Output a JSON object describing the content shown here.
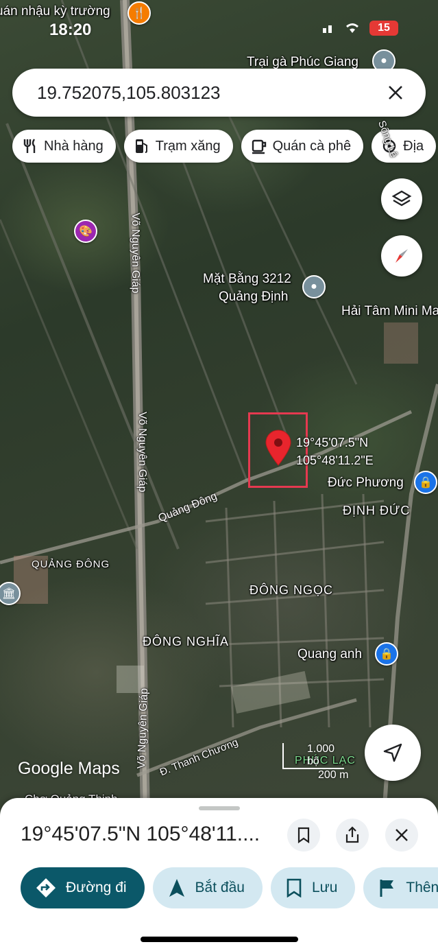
{
  "status_bar": {
    "time": "18:20",
    "battery": "15"
  },
  "search": {
    "value": "19.752075,105.803123"
  },
  "chips": [
    {
      "label": "Nhà hàng",
      "icon": "fork-knife-icon"
    },
    {
      "label": "Trạm xăng",
      "icon": "gas-station-icon"
    },
    {
      "label": "Quán cà phê",
      "icon": "coffee-cup-icon"
    },
    {
      "label": "Địa",
      "icon": "attraction-icon"
    }
  ],
  "map": {
    "labels": {
      "top_left_poi": "uán nhậu kỳ trường",
      "trai_ga": "Trại gà Phúc Giang",
      "mat_bang_1": "Mặt Bằng 3212",
      "mat_bang_2": "Quảng Định",
      "hai_tam": "Hải Tâm Mini Ma",
      "duc_phuong": "Đức Phương",
      "dinh_duc": "ĐỊNH ĐỨC",
      "quang_dong_area": "QUẢNG ĐÔNG",
      "dong_ngoc": "ĐÔNG NGỌC",
      "dong_nghia": "ĐÔNG NGHĨA",
      "quang_anh": "Quang anh",
      "phuc_lac": "PHÚC LẠC",
      "cho_quang": "Chợ Quảng Thịnh"
    },
    "roads": {
      "vo_nguyen_giap_1": "Võ Nguyên Giáp",
      "vo_nguyen_giap_2": "Võ Nguyên Giáp",
      "vo_nguyen_giap_3": "Võ Nguyên Giáp",
      "quang_dong": "Quảng Đông",
      "thanh_chuong": "Đ. Thanh Chương",
      "song": "Sông Lê"
    },
    "pin": {
      "lat_label": "19°45'07.5\"N",
      "lng_label": "105°48'11.2\"E",
      "color": "#e8252d"
    },
    "google_logo": "Google Maps",
    "scale": {
      "imperial": "1.000 bộ",
      "metric": "200 m"
    }
  },
  "sheet": {
    "title": "19°45'07.5\"N 105°48'11....",
    "actions": [
      {
        "label": "Đường đi",
        "icon": "directions-icon"
      },
      {
        "label": "Bắt đầu",
        "icon": "navigation-arrow-icon"
      },
      {
        "label": "Lưu",
        "icon": "bookmark-icon"
      },
      {
        "label": "Thên",
        "icon": "flag-icon"
      }
    ]
  },
  "colors": {
    "primary": "#0b5869",
    "action_bg": "#d3e8f1",
    "pin": "#e8252d",
    "poi_blue": "#1a73e8"
  }
}
